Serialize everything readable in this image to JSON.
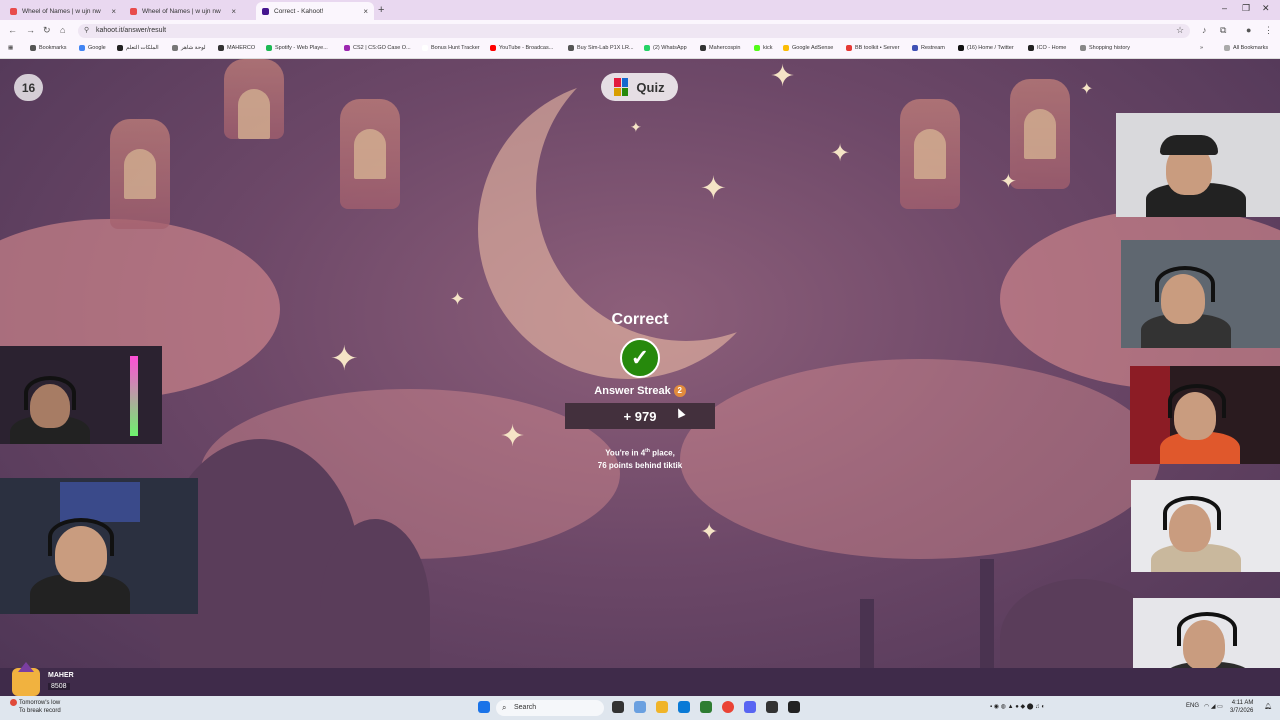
{
  "browser": {
    "tabs": [
      {
        "title": "Wheel of Names | w ujn nw",
        "active": false
      },
      {
        "title": "Wheel of Names | w ujn nw",
        "active": false
      },
      {
        "title": "Correct - Kahoot!",
        "active": true
      }
    ],
    "url": "kahoot.it/answer/result",
    "bookmarks": [
      "Bookmarks",
      "Google",
      "الملكات التعلم",
      "لوحة شاهر",
      "MAHERCO",
      "Spotify - Web Playe...",
      "CS2 | CS:GO Case O...",
      "Bonus Hunt Tracker",
      "YouTube - Broadcas...",
      "Buy Sim-Lab P1X LR...",
      "(2) WhatsApp",
      "Mahercospin",
      "kick",
      "Google AdSense",
      "BB toolkit • Server",
      "Restream",
      "(16) Home / Twitter",
      "ICO - Home",
      "Shopping history"
    ],
    "all_bookmarks": "All Bookmarks"
  },
  "game": {
    "question_number": "16",
    "mode_label": "Quiz",
    "result_title": "Correct",
    "streak_label": "Answer Streak",
    "streak_count": "2",
    "points": "+ 979",
    "place_line_prefix": "You're in 4",
    "place_sup": "th",
    "place_line_suffix": " place,",
    "behind_line": "76 points behind tiktik"
  },
  "player": {
    "name": "MAHER",
    "score": "8508"
  },
  "taskbar": {
    "weather_line1": "Tomorrow's low",
    "weather_line2": "To break record",
    "search_placeholder": "Search",
    "lang": "ENG",
    "time": "4:11 AM",
    "date": "3/7/2026"
  },
  "colors": {
    "correct_green": "#26890c",
    "streak_orange": "#e28b3c",
    "footer_bar": "#3f2b4a"
  }
}
